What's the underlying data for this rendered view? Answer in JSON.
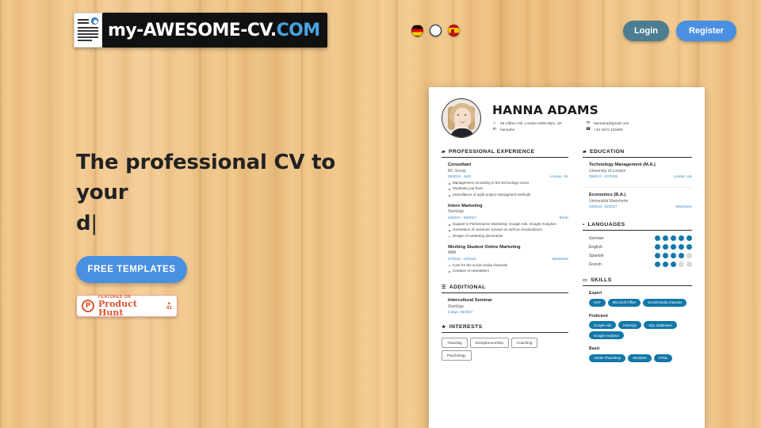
{
  "header": {
    "logo": {
      "text_main": "my-AWESOME-CV.",
      "text_com": "COM",
      "icon": "document-person-icon"
    },
    "flags": [
      {
        "name": "german-flag",
        "label": "Deutsch"
      },
      {
        "name": "uk-flag",
        "label": "English"
      },
      {
        "name": "spanish-flag",
        "label": "Español"
      }
    ],
    "login_label": "Login",
    "register_label": "Register",
    "login_color": "#4d7d90",
    "register_color": "#4a90e2"
  },
  "hero": {
    "headline_line1": "The professional CV to your",
    "headline_line2": "d",
    "cursor": "|",
    "cta_label": "FREE TEMPLATES",
    "product_hunt": {
      "featured_label": "FEATURED ON",
      "name": "Product Hunt",
      "upvote_arrow": "▲",
      "count": "41"
    }
  },
  "cv": {
    "name": "HANNA ADAMS",
    "avatar": "profile-photo",
    "contacts_left": [
      {
        "icon": "home-icon",
        "glyph": "⌂",
        "text": "58 Clifton Hill, London NW8 0QG, UK"
      },
      {
        "icon": "linkedin-icon",
        "glyph": "in",
        "text": "hannahs"
      }
    ],
    "contacts_right": [
      {
        "icon": "email-icon",
        "glyph": "✉",
        "text": "hannaha@gmail.com"
      },
      {
        "icon": "phone-icon",
        "glyph": "☎",
        "text": "+44 1872 123456"
      }
    ],
    "experience": {
      "title": "PROFESSIONAL EXPERIENCE",
      "icon": "briefcase-icon",
      "glyph": "ὋC",
      "items": [
        {
          "role": "Consultant",
          "org": "BC Group",
          "dates": "09/2019 - Jetzt",
          "location": "London, UK",
          "bullets": [
            "Management consulting in the technology sector",
            "Moderate jour fixes",
            "Surveillance of agile project managment methods"
          ]
        },
        {
          "role": "Intern Marketing",
          "org": "StartUpp",
          "dates": "03/2017 - 08/2017",
          "location": "Berlin",
          "bullets": [
            "Support in Performance Marketing: Google Ads, Google Analytics",
            "Generation of customer surveys as well as visualizations",
            "Design of marketing documents"
          ]
        },
        {
          "role": "Working Student Online Marketing",
          "org": "ABB",
          "dates": "07/2015 - 12/2016",
          "location": "Mannheim",
          "bullets": [
            "Care for the social media channels",
            "Creation of newsletters"
          ]
        }
      ]
    },
    "additional": {
      "title": "ADDITIONAL",
      "icon": "list-icon",
      "glyph": "☰",
      "items": [
        {
          "role": "Intercultural Seminar",
          "org": "StartUpp",
          "dates": "5 days, 05/2017"
        }
      ]
    },
    "interests": {
      "title": "INTERESTS",
      "icon": "star-icon",
      "glyph": "★",
      "tags": [
        "Traveling",
        "Entrepreneurship",
        "Coaching",
        "Psychology"
      ]
    },
    "education": {
      "title": "EDUCATION",
      "icon": "graduation-cap-icon",
      "glyph": "Ἱ3",
      "items": [
        {
          "degree": "Technology Management (M.A.)",
          "school": "University of London",
          "dates": "09/2017 - 07/2019",
          "location": "London, UK"
        },
        {
          "degree": "Economics (B.A.)",
          "school": "Universität Mannheim",
          "dates": "10/2013 - 02/2017",
          "location": "Mannheim"
        }
      ]
    },
    "languages": {
      "title": "LANGUAGES",
      "icon": "speech-bubble-icon",
      "glyph": "■",
      "max": 5,
      "items": [
        {
          "name": "German",
          "level": 5
        },
        {
          "name": "English",
          "level": 5
        },
        {
          "name": "Spanish",
          "level": 4
        },
        {
          "name": "French",
          "level": 3
        }
      ]
    },
    "skills": {
      "title": "SKILLS",
      "icon": "monitor-icon",
      "glyph": "Ὓ5",
      "groups": [
        {
          "label": "Expert",
          "tags": [
            "SAP",
            "Microsoft Office",
            "Social Media channels"
          ]
        },
        {
          "label": "Proficient",
          "tags": [
            "Google Ads",
            "InDesign",
            "SQL databases",
            "Google Analytics"
          ]
        },
        {
          "label": "Basic",
          "tags": [
            "Adobe Photoshop",
            "Windows",
            "HTML"
          ]
        }
      ]
    },
    "accent_color": "#1278a8",
    "date_color": "#2f86c5"
  }
}
